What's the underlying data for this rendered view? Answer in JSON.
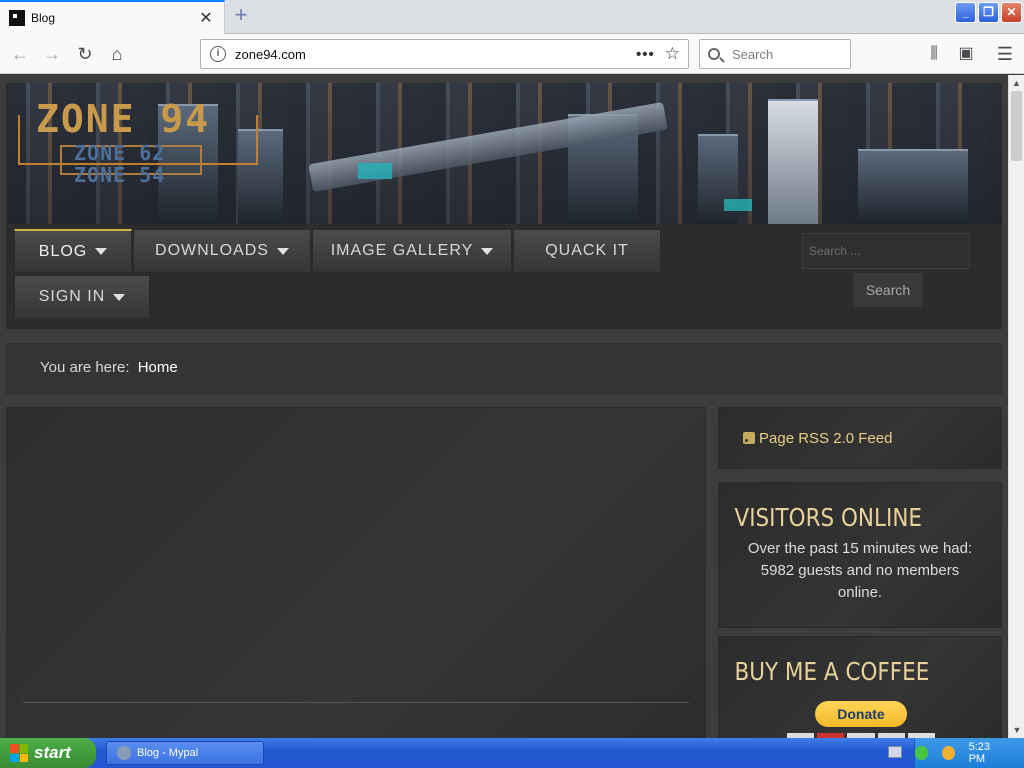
{
  "browser": {
    "tab_title": "Blog",
    "tab_close": "✕",
    "new_tab": "+",
    "url": "zone94.com",
    "search_placeholder": "Search",
    "page_actions": "•••"
  },
  "site": {
    "logo_main": "ZONE 94",
    "logo_sub1": "ZONE 62",
    "logo_sub2": "ZONE 54",
    "menu": [
      {
        "label": "BLOG",
        "has_dropdown": true,
        "active": true
      },
      {
        "label": "DOWNLOADS",
        "has_dropdown": true,
        "active": false
      },
      {
        "label": "IMAGE GALLERY",
        "has_dropdown": true,
        "active": false
      },
      {
        "label": "QUACK IT",
        "has_dropdown": false,
        "active": false
      },
      {
        "label": "SIGN IN",
        "has_dropdown": true,
        "active": false
      }
    ],
    "search_placeholder": "Search ...",
    "search_button": "Search",
    "breadcrumb_prefix": "You are here:",
    "breadcrumb_current": "Home",
    "sidebar": {
      "rss_label": "Page RSS 2.0 Feed",
      "visitors_title": "VISITORS ONLINE",
      "visitors_text": "Over the past 15 minutes we had: 5982 guests and no members online.",
      "coffee_title": "BUY ME A COFFEE",
      "donate_label": "Donate"
    },
    "accent_color": "#d6b24a"
  },
  "taskbar": {
    "start_label": "start",
    "task_item": "Blog - Mypal",
    "clock": "5:23 PM"
  }
}
